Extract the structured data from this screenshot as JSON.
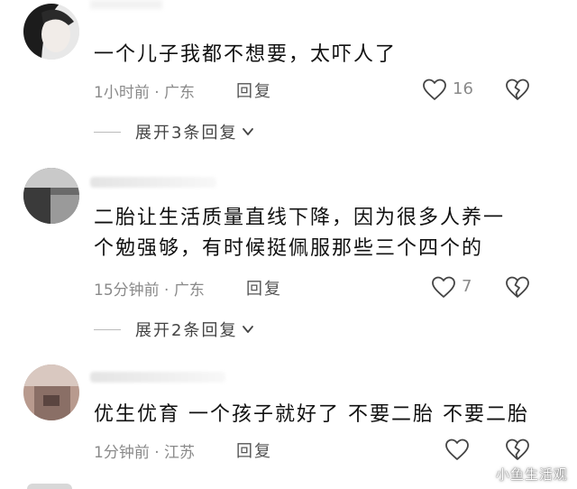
{
  "comments": [
    {
      "text_lines": [
        "一个儿子我都不想要，太吓人了"
      ],
      "time": "1小时前",
      "location": "广东",
      "reply_label": "回复",
      "likes": "16",
      "expand_label": "展开3条回复"
    },
    {
      "text_lines": [
        "二胎让生活质量直线下降，因为很多人养一",
        "个勉强够，有时候挺佩服那些三个四个的"
      ],
      "time": "15分钟前",
      "location": "广东",
      "reply_label": "回复",
      "likes": "7",
      "expand_label": "展开2条回复"
    },
    {
      "text_lines": [
        "优生优育 一个孩子就好了 不要二胎 不要二胎"
      ],
      "time": "1分钟前",
      "location": "江苏",
      "reply_label": "回复",
      "likes": ""
    }
  ],
  "meta_separator": " · ",
  "watermark": "小鱼生活观",
  "icons": {
    "like": "heart-outline-icon",
    "dislike": "broken-heart-icon",
    "expand": "chevron-down-icon"
  },
  "colors": {
    "text": "#111111",
    "meta": "#8a8a8a",
    "icon": "#444444"
  }
}
